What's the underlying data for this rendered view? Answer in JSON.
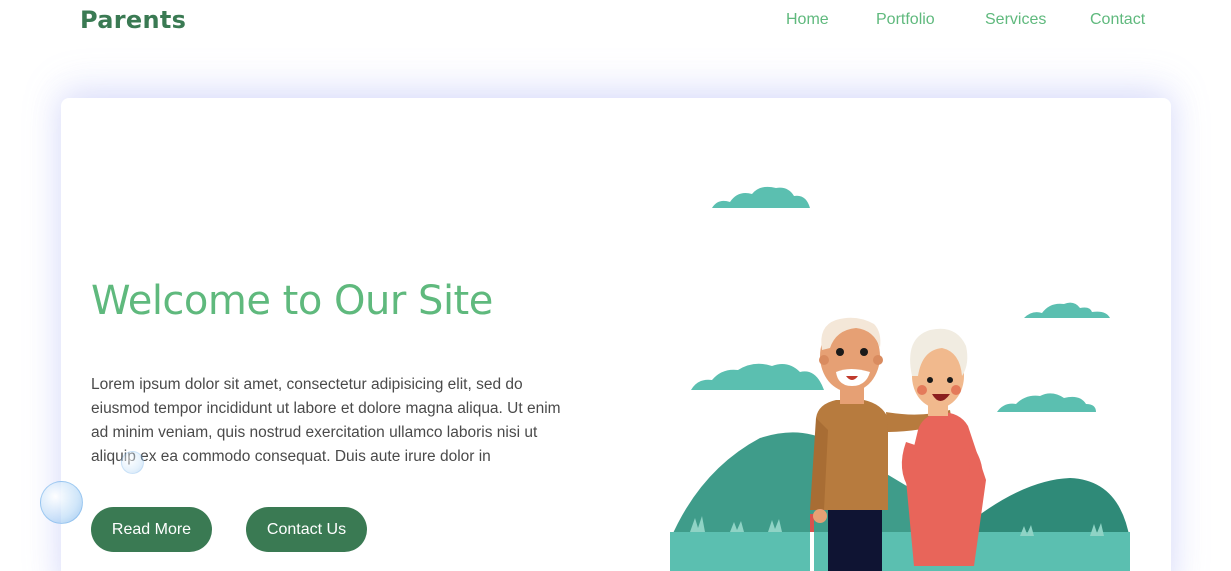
{
  "header": {
    "logo": "Parents",
    "nav": [
      {
        "label": "Home"
      },
      {
        "label": "Portfolio"
      },
      {
        "label": "Services"
      },
      {
        "label": "Contact"
      }
    ]
  },
  "hero": {
    "title": "Welcome to Our Site",
    "body": "Lorem ipsum dolor sit amet, consectetur adipisicing elit, sed do eiusmod tempor incididunt ut labore et dolore magna aliqua. Ut enim ad minim veniam, quis nostrud exercitation ullamco laboris nisi ut aliquip ex ea commodo consequat. Duis aute irure dolor in",
    "buttons": {
      "read_more": "Read More",
      "contact_us": "Contact Us"
    }
  },
  "illustration": {
    "name": "elderly-couple-illustration"
  },
  "colors": {
    "brand_dark": "#3a7a53",
    "brand_light": "#5fb97d",
    "teal": "#5bbfb0",
    "hill": "#3f9c8a"
  }
}
